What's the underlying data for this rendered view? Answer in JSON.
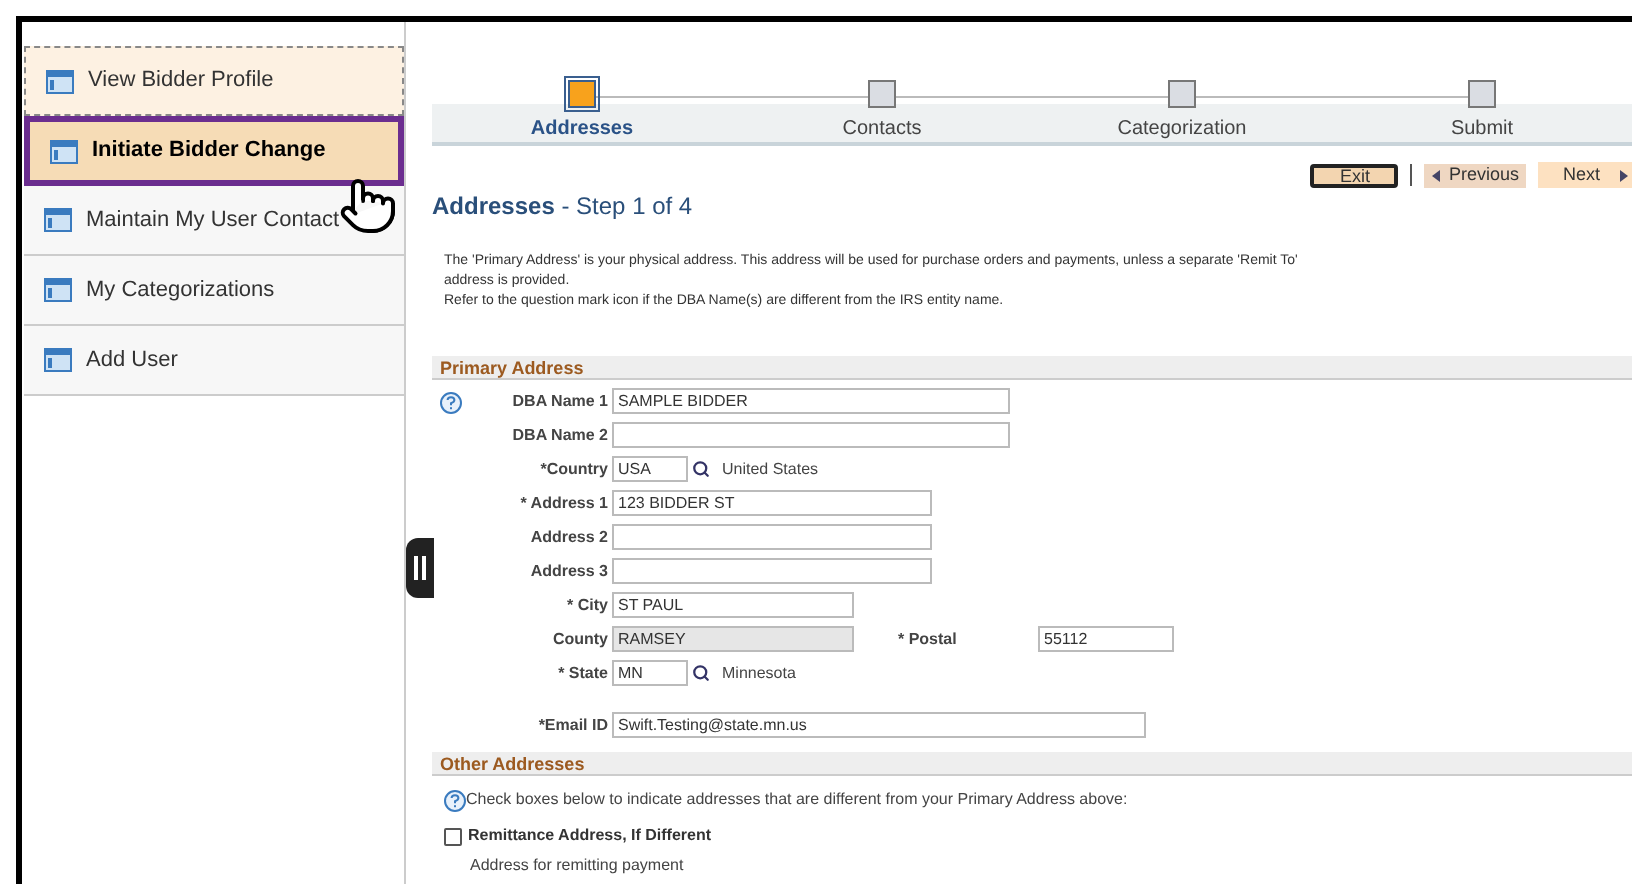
{
  "sidebar": {
    "items": [
      {
        "label": "View Bidder Profile",
        "selected": false
      },
      {
        "label": "Initiate Bidder Change",
        "selected": true
      },
      {
        "label": "Maintain My User Contact",
        "selected": false
      },
      {
        "label": "My Categorizations",
        "selected": false
      },
      {
        "label": "Add User",
        "selected": false
      }
    ]
  },
  "steps": [
    {
      "label": "Addresses",
      "selected": true
    },
    {
      "label": "Contacts",
      "selected": false
    },
    {
      "label": "Categorization",
      "selected": false
    },
    {
      "label": "Submit",
      "selected": false
    }
  ],
  "buttons": {
    "exit": "Exit",
    "previous": "Previous",
    "next": "Next"
  },
  "page_title": {
    "main": "Addresses",
    "sub": "- Step 1 of 4"
  },
  "intro": [
    "The 'Primary Address' is your physical address. This address will be used for purchase orders and payments, unless a separate 'Remit To' address is provided.",
    "Refer to the question mark icon if the DBA Name(s) are different from the IRS entity name."
  ],
  "primary_address": {
    "title": "Primary Address",
    "rows": [
      {
        "label": "DBA Name 1",
        "value": "SAMPLE BIDDER",
        "kind": "long",
        "help": true
      },
      {
        "label": "DBA Name 2",
        "value": "",
        "kind": "long"
      },
      {
        "label": "*Country",
        "value": "USA",
        "kind": "lookup",
        "description": "United States"
      },
      {
        "label": "* Address 1",
        "value": "123 BIDDER ST",
        "kind": "medium"
      },
      {
        "label": "Address 2",
        "value": "",
        "kind": "medium"
      },
      {
        "label": "Address 3",
        "value": "",
        "kind": "medium"
      },
      {
        "label": "* City",
        "value": "ST PAUL",
        "kind": "short"
      },
      {
        "label": "County",
        "value": "RAMSEY",
        "kind": "short",
        "disabled": true,
        "extra": {
          "label": "* Postal",
          "value": "55112"
        }
      },
      {
        "label": "* State",
        "value": "MN",
        "kind": "lookup",
        "description": "Minnesota"
      },
      {
        "label": "*Email ID",
        "value": "Swift.Testing@state.mn.us",
        "kind": "email"
      }
    ]
  },
  "other_addresses": {
    "title": "Other Addresses",
    "note": "Check boxes below to indicate addresses that are different from your Primary Address above:",
    "options": [
      {
        "label": "Remittance Address, If Different",
        "checked": false,
        "description": "Address for remitting payment"
      }
    ]
  }
}
